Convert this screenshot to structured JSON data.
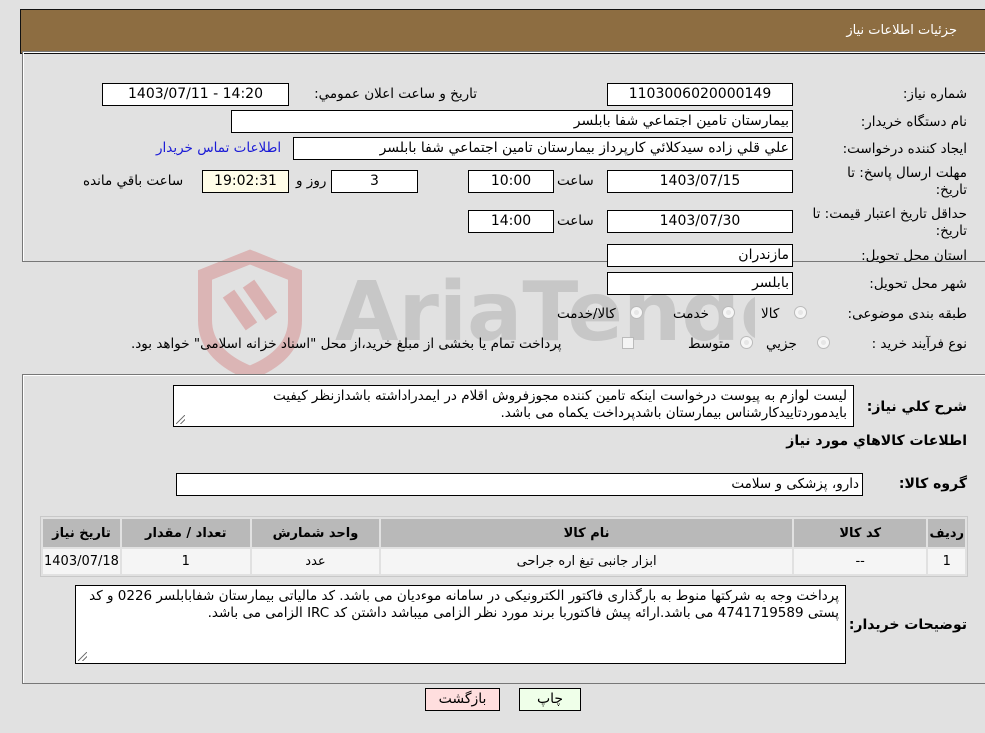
{
  "header": {
    "title": "جزئيات اطلاعات نياز"
  },
  "details": {
    "need_number": {
      "label": "شماره نياز:",
      "value": "1103006020000149"
    },
    "announce": {
      "label": "تاريخ و ساعت اعلان عمومي:",
      "value": "1403/07/11 - 14:20"
    },
    "buyer_org": {
      "label": "نام دستگاه خريدار:",
      "value": "بيمارستان تامين اجتماعي شفا بابلسر"
    },
    "creator": {
      "label": "ايجاد كننده درخواست:",
      "value": "علي قلي زاده سيدكلائي كارپرداز بيمارستان تامين اجتماعي شفا بابلسر"
    },
    "contact_link": "اطلاعات تماس خريدار",
    "deadline": {
      "label": "مهلت ارسال پاسخ: تا تاريخ:",
      "date": "1403/07/15",
      "time_label": "ساعت",
      "time": "10:00",
      "days": "3",
      "days_label": "روز و",
      "remaining": "19:02:31",
      "remaining_label": "ساعت باقي مانده"
    },
    "price_validity": {
      "label": "حداقل تاريخ اعتبار قيمت: تا تاريخ:",
      "date": "1403/07/30",
      "time_label": "ساعت",
      "time": "14:00"
    },
    "province": {
      "label": "استان محل تحويل:",
      "value": "مازندران"
    },
    "city": {
      "label": "شهر محل تحويل:",
      "value": "بابلسر"
    },
    "category": {
      "label": "طبقه بندی موضوعی:",
      "options": [
        "كالا",
        "خدمت",
        "كالا/خدمت"
      ]
    },
    "purchase_type": {
      "label": "نوع فرآيند خريد :",
      "options": [
        "جزيي",
        "متوسط"
      ],
      "note": "پرداخت تمام يا بخشی از مبلغ خريد،از محل \"اسناد خزانه اسلامی\" خواهد بود."
    }
  },
  "description": {
    "label": "شرح كلي نياز:",
    "value": "ليست لوازم به پيوست درخواست اينكه تامين كننده مجوزفروش اقلام در ايمدراداشته باشدازنظر كيفيت بايدموردتاييدكارشناس بيمارستان باشدپرداخت يكماه می باشد."
  },
  "goods": {
    "section_title": "اطلاعات كالاهاي مورد نياز",
    "group_label": "گروه كالا:",
    "group_value": "دارو، پزشكی و سلامت",
    "table": {
      "headers": [
        "رديف",
        "كد كالا",
        "نام كالا",
        "واحد شمارش",
        "تعداد / مقدار",
        "تاريخ نياز"
      ],
      "rows": [
        [
          "1",
          "--",
          "ابزار جانبی تيغ اره جراحی",
          "عدد",
          "1",
          "1403/07/18"
        ]
      ]
    }
  },
  "buyer_notes": {
    "label": "توضيحات خريدار:",
    "value": "پرداخت وجه به شركتها منوط به بارگذاری فاكتور الكترونيكی در سامانه موءديان می باشد. كد مالياتی بيمارستان شفابابلسر 0226 و كد پستی 4741719589 می باشد.ارائه پيش فاكتوربا برند مورد نظر الزامی ميباشد داشتن كد IRC الزامی می باشد."
  },
  "buttons": {
    "print": "چاپ",
    "back": "بازگشت"
  },
  "colors": {
    "header_bg": "#8d6d41",
    "back_button_bg": "#ffdede",
    "print_button_bg": "#efffe9",
    "link": "#1a1ad6"
  }
}
